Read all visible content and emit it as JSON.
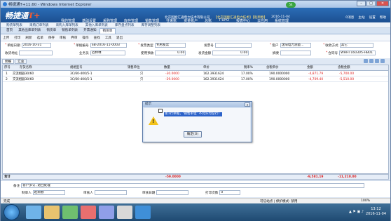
{
  "window": {
    "title": "畅捷通T+11.60 - Windows Internet Explorer",
    "badge": "54"
  },
  "header": {
    "logo_text": "畅捷通",
    "logo_mark": "T+",
    "main_menu": [
      "我的管理",
      "基础设置",
      "采购管理",
      "库存管理",
      "销售管理",
      "往来账",
      "资金账户",
      "总账",
      "T-UFO",
      "报表中心",
      "云应用",
      "系统管理"
    ],
    "company": "北京国能汇通电力技术有限公司",
    "account": "【北京国能汇通电力技术】【赵雨春】",
    "date": "2016-11-04",
    "tools": [
      "0消息",
      "主站",
      "设置",
      "帮助"
    ]
  },
  "quick_links": [
    "购货单列表",
    "采购订单列表",
    "采购入库单列表",
    "其他入库单列表",
    "库存盘点列表",
    "库存调整列表"
  ],
  "tabs": [
    "首页",
    "其他出库单列表",
    "销货单",
    "销售单列表",
    "开票通知",
    "销货单"
  ],
  "toolbar": [
    "上传",
    "打印",
    "刷新",
    "选单",
    "保存",
    "审核",
    "弃审",
    "操作",
    "查找",
    "工具",
    "退出"
  ],
  "form": {
    "doc_date_label": "单据日期",
    "doc_date": "2016-10-31",
    "doc_no_label": "单据编号",
    "doc_no": "SB-2016-11-0003",
    "type_label": "发票类型",
    "type": "专用发票",
    "invoice_no_label": "发票号",
    "invoice_no": "",
    "customer_label": "客户",
    "customer": "沈阳电力测量...",
    "recv_method_label": "收款方式",
    "recv_method": "其它",
    "recv_label": "收货地址",
    "recv": "",
    "salesman_label": "业务员",
    "salesman": "范林林",
    "use_prepay_label": "使用预收",
    "use_prepay": "0.00",
    "exp_label": "发货金额",
    "exp": "0.00",
    "note2_label": "摘要",
    "note2": "",
    "contract_label": "合同号",
    "contract": "WHHT160305-HB01"
  },
  "body_tabs": [
    "明细",
    "汇总"
  ],
  "grid": {
    "columns": [
      "序号",
      "存货名称",
      "规格型号",
      "销售单位",
      "数量",
      "单价",
      "税率%",
      "含税单价",
      "金额",
      "含税金额"
    ],
    "rows": [
      [
        "1",
        "交流相器30/60",
        "3C/60-400/5-1",
        "只",
        "-30.0000",
        "162.3931624",
        "17.00%",
        "190.0000000",
        "-4,871.79",
        "-5,700.00"
      ],
      [
        "2",
        "交流相器30/60",
        "3C/60-400/5-1",
        "只",
        "-29.0000",
        "162.3931624",
        "17.00%",
        "190.0000000",
        "-4,709.40",
        "-5,510.00"
      ]
    ],
    "footer": {
      "label": "合计",
      "qty": "-59.0000",
      "amount": "-9,581.19",
      "tax_amount": "-11,210.00"
    }
  },
  "bottom": {
    "remark_label": "备注",
    "remark": "客户多订, 退回处理",
    "maker_label": "制单人",
    "maker": "赵雨春",
    "auditor_label": "审核人",
    "auditor": "",
    "audit_date_label": "审核日期",
    "audit_date": "",
    "print_label": "打印次数",
    "print": "0"
  },
  "status": {
    "left": "完成",
    "zone": "可信站点 | 保护模式: 禁用",
    "zoom": "100%"
  },
  "taskbar": {
    "time": "13:12",
    "date": "2016-11-04"
  },
  "dialog": {
    "title": "提示",
    "message": "第1行单据，‘销售单位’ 不允许为空行！",
    "ok": "确定(O)"
  }
}
